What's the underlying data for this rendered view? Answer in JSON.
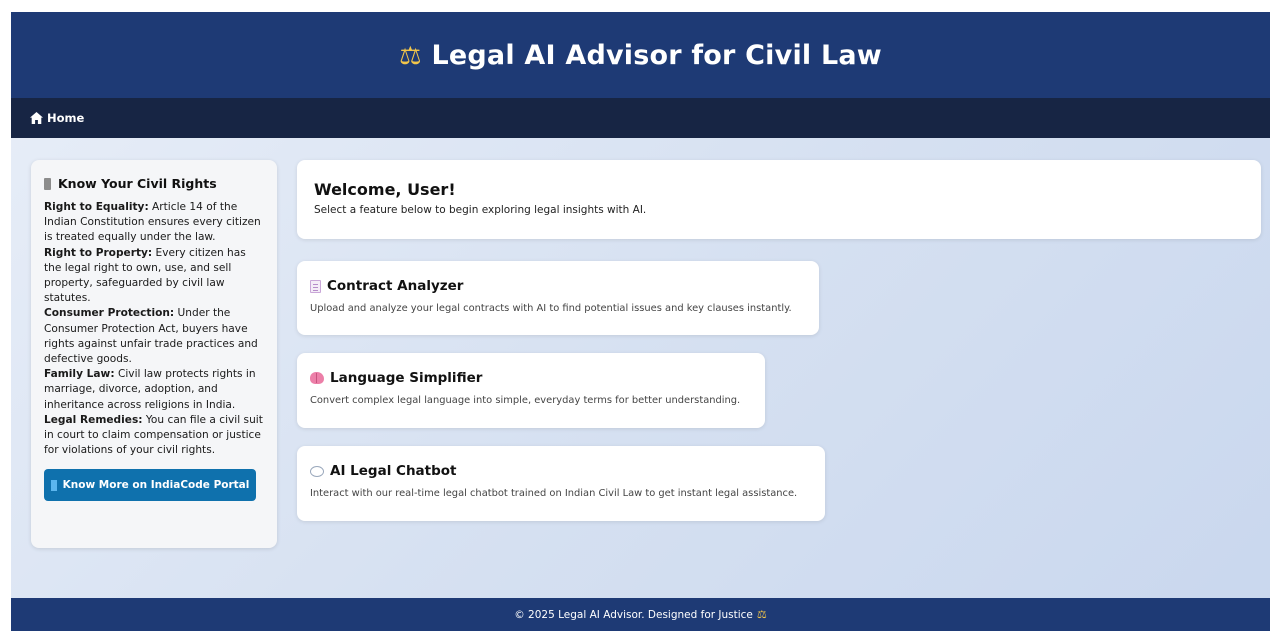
{
  "header": {
    "icon": "balance-scale-icon",
    "icon_glyph": "⚖",
    "title": "Legal AI Advisor for Civil Law"
  },
  "nav": {
    "home_icon": "home-icon",
    "home_label": "Home"
  },
  "sidebar": {
    "icon": "scroll-icon",
    "title": "Know Your Civil Rights",
    "items": [
      {
        "term": "Right to Equality:",
        "text": " Article 14 of the Indian Constitution ensures every citizen is treated equally under the law."
      },
      {
        "term": "Right to Property:",
        "text": " Every citizen has the legal right to own, use, and sell property, safeguarded by civil law statutes."
      },
      {
        "term": "Consumer Protection:",
        "text": " Under the Consumer Protection Act, buyers have rights against unfair trade practices and defective goods."
      },
      {
        "term": "Family Law:",
        "text": " Civil law protects rights in marriage, divorce, adoption, and inheritance across religions in India."
      },
      {
        "term": "Legal Remedies:",
        "text": " You can file a civil suit in court to claim compensation or justice for violations of your civil rights."
      }
    ],
    "button_icon": "book-icon",
    "button_label": "Know More on IndiaCode Portal"
  },
  "welcome": {
    "title": "Welcome, User!",
    "subtitle": "Select a feature below to begin exploring legal insights with AI."
  },
  "features": [
    {
      "icon": "document-icon",
      "title": "Contract Analyzer",
      "description": "Upload and analyze your legal contracts with AI to find potential issues and key clauses instantly."
    },
    {
      "icon": "brain-icon",
      "title": "Language Simplifier",
      "description": "Convert complex legal language into simple, everyday terms for better understanding."
    },
    {
      "icon": "speech-bubble-icon",
      "title": "AI Legal Chatbot",
      "description": "Interact with our real-time legal chatbot trained on Indian Civil Law to get instant legal assistance."
    }
  ],
  "footer": {
    "text": "© 2025 Legal AI Advisor. Designed for Justice",
    "icon_glyph": "⚖"
  },
  "colors": {
    "header_bg": "#1e3a75",
    "nav_bg": "#172544",
    "button_bg": "#0f71ad",
    "accent_gold": "#f3c64a"
  }
}
